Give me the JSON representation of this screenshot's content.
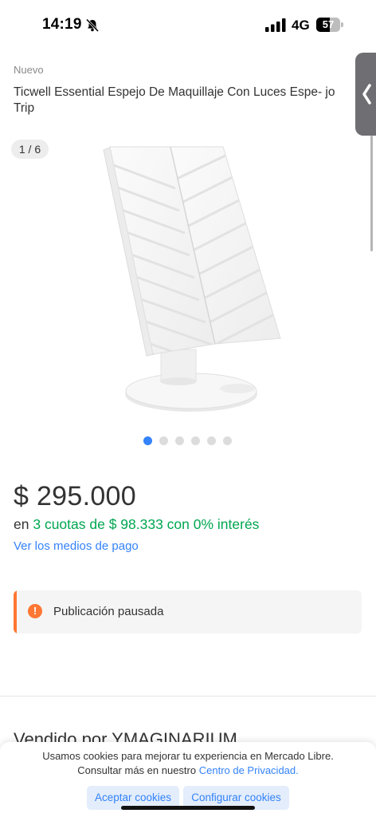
{
  "status_bar": {
    "time": "14:19",
    "network": "4G",
    "battery_percent": "57",
    "battery_level": 0.57
  },
  "product": {
    "condition": "Nuevo",
    "title": "Ticwell Essential Espejo De Maquillaje Con Luces Espe- jo Trip",
    "gallery_counter": "1 / 6",
    "gallery_total": 6,
    "gallery_active_index": 0
  },
  "pricing": {
    "price": "$ 295.000",
    "installments_prefix": "en",
    "installments_highlight": "3 cuotas de $ 98.333 con 0% interés",
    "payment_link": "Ver los medios de pago"
  },
  "notice": {
    "icon": "!",
    "text": "Publicación pausada"
  },
  "seller": {
    "partial_text": "Vendido por YMAGINARIUM"
  },
  "cookie_banner": {
    "line1": "Usamos cookies para mejorar tu experiencia en Mercado Libre.",
    "line2_prefix": "Consultar más en nuestro",
    "line2_link": "Centro de Privacidad.",
    "accept_label": "Aceptar cookies",
    "configure_label": "Configurar cookies"
  },
  "colors": {
    "accent_blue": "#3483fa",
    "green": "#00a650",
    "warning_orange": "#ff7733"
  },
  "icons": {
    "bell": "bell-slash-icon",
    "signal": "signal-bars-icon",
    "battery": "battery-icon",
    "back": "chevron-left-icon",
    "warning": "exclamation-circle-icon"
  }
}
